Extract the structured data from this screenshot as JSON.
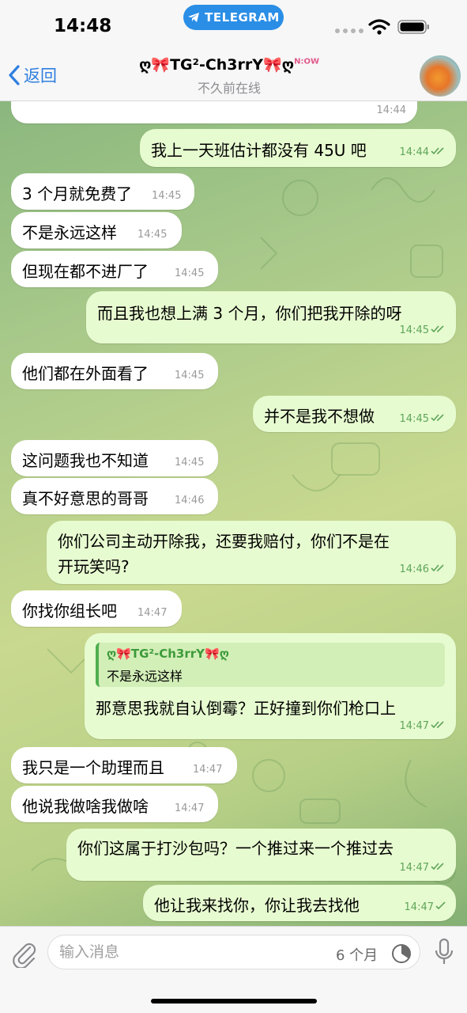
{
  "status_bar": {
    "time": "14:48",
    "app_pill": "TELEGRAM"
  },
  "header": {
    "back_label": "返回",
    "title": "ღ🎀TG²-Ch3rrY🎀ღ",
    "title_badge": "N:OW",
    "subtitle": "不久前在线",
    "avatar_icon": "avatar-photo"
  },
  "messages": [
    {
      "dir": "in",
      "text": "",
      "time": "14:44"
    },
    {
      "dir": "out",
      "text": "我上一天班估计都没有 45U 吧",
      "time": "14:44",
      "read": true
    },
    {
      "dir": "in",
      "text": "3 个月就免费了",
      "time": "14:45"
    },
    {
      "dir": "in",
      "text": "不是永远这样",
      "time": "14:45"
    },
    {
      "dir": "in",
      "text": "但现在都不进厂了",
      "time": "14:45"
    },
    {
      "dir": "out",
      "text": "而且我也想上满 3 个月，你们把我开除的呀",
      "time": "14:45",
      "read": true
    },
    {
      "dir": "in",
      "text": "他们都在外面看了",
      "time": "14:45"
    },
    {
      "dir": "out",
      "text": "并不是我不想做",
      "time": "14:45",
      "read": true
    },
    {
      "dir": "in",
      "text": "这问题我也不知道",
      "time": "14:45"
    },
    {
      "dir": "in",
      "text": "真不好意思的哥哥",
      "time": "14:46"
    },
    {
      "dir": "out",
      "text_line1": "你们公司主动开除我，还要我赔付，你们不是在",
      "text_line2": "开玩笑吗?",
      "time": "14:46",
      "read": true
    },
    {
      "dir": "in",
      "text": "你找你组长吧",
      "time": "14:47"
    },
    {
      "dir": "out",
      "reply_name": "ღ🎀TG²-Ch3rrY🎀ღ",
      "reply_text": "不是永远这样",
      "text": "那意思我就自认倒霉？正好撞到你们枪口上",
      "time": "14:47",
      "read": true
    },
    {
      "dir": "in",
      "text": "我只是一个助理而且",
      "time": "14:47"
    },
    {
      "dir": "in",
      "text": "他说我做啥我做啥",
      "time": "14:47"
    },
    {
      "dir": "out",
      "text": "你们这属于打沙包吗？一个推过来一个推过去",
      "time": "14:47",
      "read": true
    },
    {
      "dir": "out",
      "text": "他让我来找你，你让我去找他",
      "time": "14:47",
      "read": false
    }
  ],
  "input_bar": {
    "placeholder": "输入消息",
    "timer_label": "6 个月",
    "icons": [
      "paperclip-icon",
      "timer-icon",
      "microphone-icon"
    ]
  },
  "colors": {
    "incoming_bubble": "#ffffff",
    "outgoing_bubble": "#e7fbd0",
    "accent_blue": "#2f7fe0",
    "telegram_pill": "#2a8ee6",
    "time_green": "#5ea65a"
  }
}
